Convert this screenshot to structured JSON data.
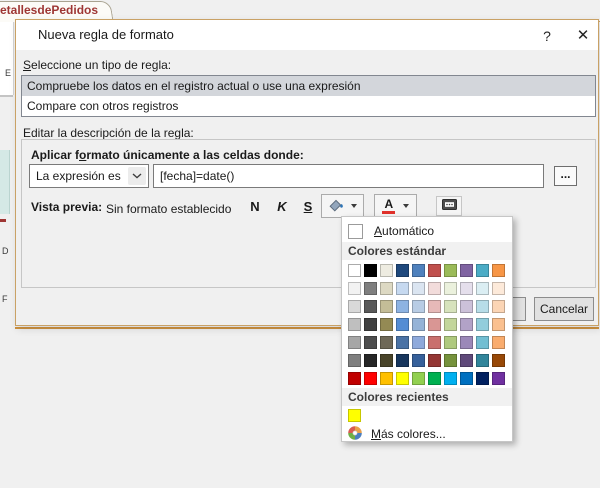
{
  "window": {
    "tab_label": "etallesdePedidos",
    "background_fragments": [
      "E",
      "D",
      "F"
    ]
  },
  "dialog": {
    "title": "Nueva regla de formato",
    "help_glyph": "?",
    "close_glyph": "✕",
    "select_rule_type": {
      "accel": "S",
      "rest": "eleccione un tipo de regla:"
    },
    "rule_types": [
      "Compruebe los datos en el registro actual o use una expresión",
      "Compare con otros registros"
    ],
    "edit_description_label": "Editar la descripción de la regla:",
    "apply_format_label": {
      "pre": "Aplicar f",
      "accel": "o",
      "rest": "rmato únicamente a las celdas donde:"
    },
    "condition_operator": "La expresión es",
    "expression": "[fecha]=date()",
    "builder_button": "...",
    "preview_label": "Vista previa:",
    "preview_text": "Sin formato establecido",
    "format_buttons": {
      "bold": "N",
      "italic": "K",
      "underline": "S"
    },
    "cancel_button": "Cancelar"
  },
  "color_picker": {
    "automatic": {
      "accel": "A",
      "rest": "utomático"
    },
    "standard_header": "Colores estándar",
    "recent_header": "Colores recientes",
    "more_colors": {
      "accel": "M",
      "rest": "ás colores..."
    },
    "recent_colors": [
      "#FFFF00"
    ],
    "grid": [
      [
        "#FFFFFF",
        "#000000",
        "#EEECE1",
        "#1F497D",
        "#4F81BD",
        "#C0504D",
        "#9BBB59",
        "#8064A2",
        "#4BACC6",
        "#F79646"
      ],
      [
        "#F2F2F2",
        "#7F7F7F",
        "#DDD9C3",
        "#C6D9F0",
        "#DBE5F1",
        "#F2DCDB",
        "#EBF1DD",
        "#E5DFEC",
        "#DBEEF3",
        "#FDEADA"
      ],
      [
        "#D9D9D9",
        "#595959",
        "#C4BD97",
        "#8DB3E2",
        "#B8CCE4",
        "#E6B9B8",
        "#D7E3BC",
        "#CCC1D9",
        "#B7DDE8",
        "#FBD5B5"
      ],
      [
        "#BFBFBF",
        "#404040",
        "#948A54",
        "#548DD4",
        "#95B3D7",
        "#D99694",
        "#C3D69B",
        "#B2A2C7",
        "#92CDDC",
        "#FAC08F"
      ],
      [
        "#A6A6A6",
        "#4D4D4D",
        "#6E6857",
        "#4A72A5",
        "#8EA9DB",
        "#C9706D",
        "#AFC97E",
        "#9B88B8",
        "#71BED2",
        "#F9AC6E"
      ],
      [
        "#7F7F7F",
        "#262626",
        "#494429",
        "#17365D",
        "#36609A",
        "#943634",
        "#76923C",
        "#5F497A",
        "#31859B",
        "#974807"
      ],
      [
        "#C00000",
        "#FF0000",
        "#FFC000",
        "#FFFF00",
        "#92D050",
        "#00B050",
        "#00B0F0",
        "#0070C0",
        "#002060",
        "#7030A0"
      ]
    ]
  },
  "colors": {
    "dialog_border": "#C9A165",
    "accent_line": "#CE9240",
    "selected_row_bg": "#D3D6DB",
    "tab_text": "#9E3634",
    "font_color_indicator": "#E0312B",
    "recent_yellow": "#FFFF00"
  }
}
